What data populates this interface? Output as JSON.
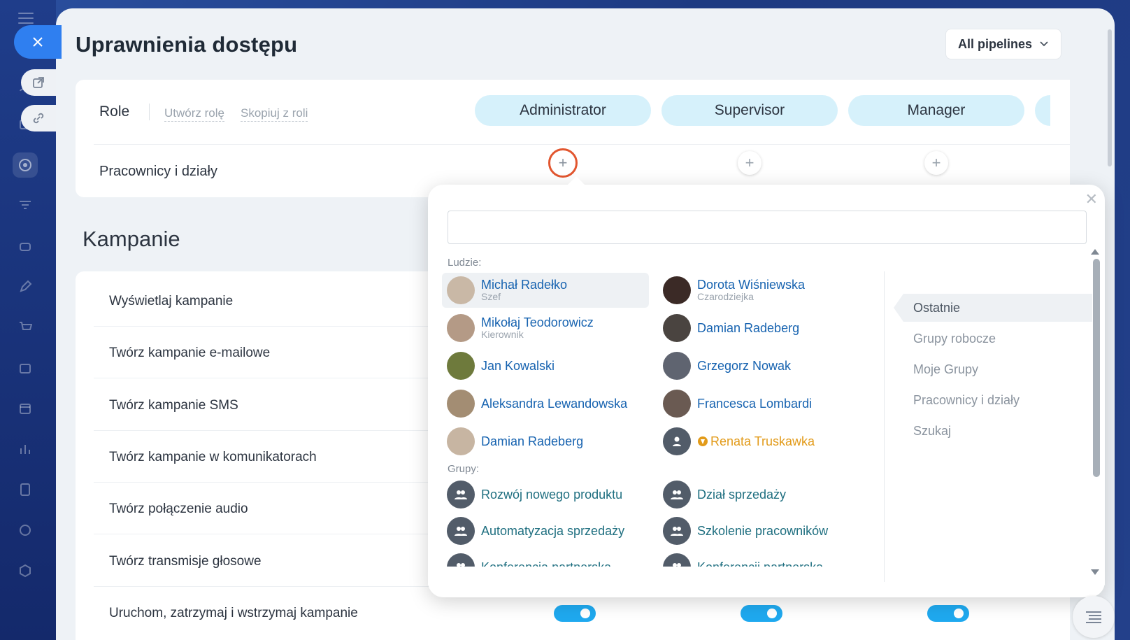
{
  "header": {
    "title": "Uprawnienia dostępu",
    "pipelines_label": "All pipelines"
  },
  "roles": {
    "label": "Role",
    "create_link": "Utwórz rolę",
    "copy_link": "Skopiuj z roli",
    "items": [
      "Administrator",
      "Supervisor",
      "Manager"
    ],
    "employees_label": "Pracownicy i działy"
  },
  "section": {
    "title": "Kampanie",
    "permissions": [
      "Wyświetlaj kampanie",
      "Twórz kampanie e-mailowe",
      "Twórz kampanie SMS",
      "Twórz kampanie w komunikatorach",
      "Twórz połączenie audio",
      "Twórz transmisje głosowe",
      "Uruchom, zatrzymaj i wstrzymaj kampanie"
    ]
  },
  "popup": {
    "search_value": "",
    "people_title": "Ludzie:",
    "groups_title": "Grupy:",
    "people": [
      {
        "name": "Michał Radełko",
        "role": "Szef"
      },
      {
        "name": "Dorota Wiśniewska",
        "role": "Czarodziejka"
      },
      {
        "name": "Mikołaj Teodorowicz",
        "role": "Kierownik"
      },
      {
        "name": "Damian Radeberg",
        "role": ""
      },
      {
        "name": "Jan Kowalski",
        "role": ""
      },
      {
        "name": "Grzegorz Nowak",
        "role": ""
      },
      {
        "name": "Aleksandra Lewandowska",
        "role": ""
      },
      {
        "name": "Francesca Lombardi",
        "role": ""
      },
      {
        "name": "Damian Radeberg",
        "role": ""
      },
      {
        "name": "Renata Truskawka",
        "role": ""
      }
    ],
    "groups": [
      "Rozwój nowego produktu",
      "Dział sprzedaży",
      "Automatyzacja sprzedaży",
      "Szkolenie pracowników",
      "Konferencja partnerska",
      "Konferencji partnerska"
    ],
    "tabs": [
      "Ostatnie",
      "Grupy robocze",
      "Moje Grupy",
      "Pracownicy i działy",
      "Szukaj"
    ]
  },
  "colors": {
    "accent": "#2f7ff0",
    "role_pill": "#d6f1fb",
    "toggle_on": "#1fa9ef",
    "link_name": "#1763b0",
    "extranet_name": "#e29b1a",
    "active_plus_border": "#e2562f"
  }
}
